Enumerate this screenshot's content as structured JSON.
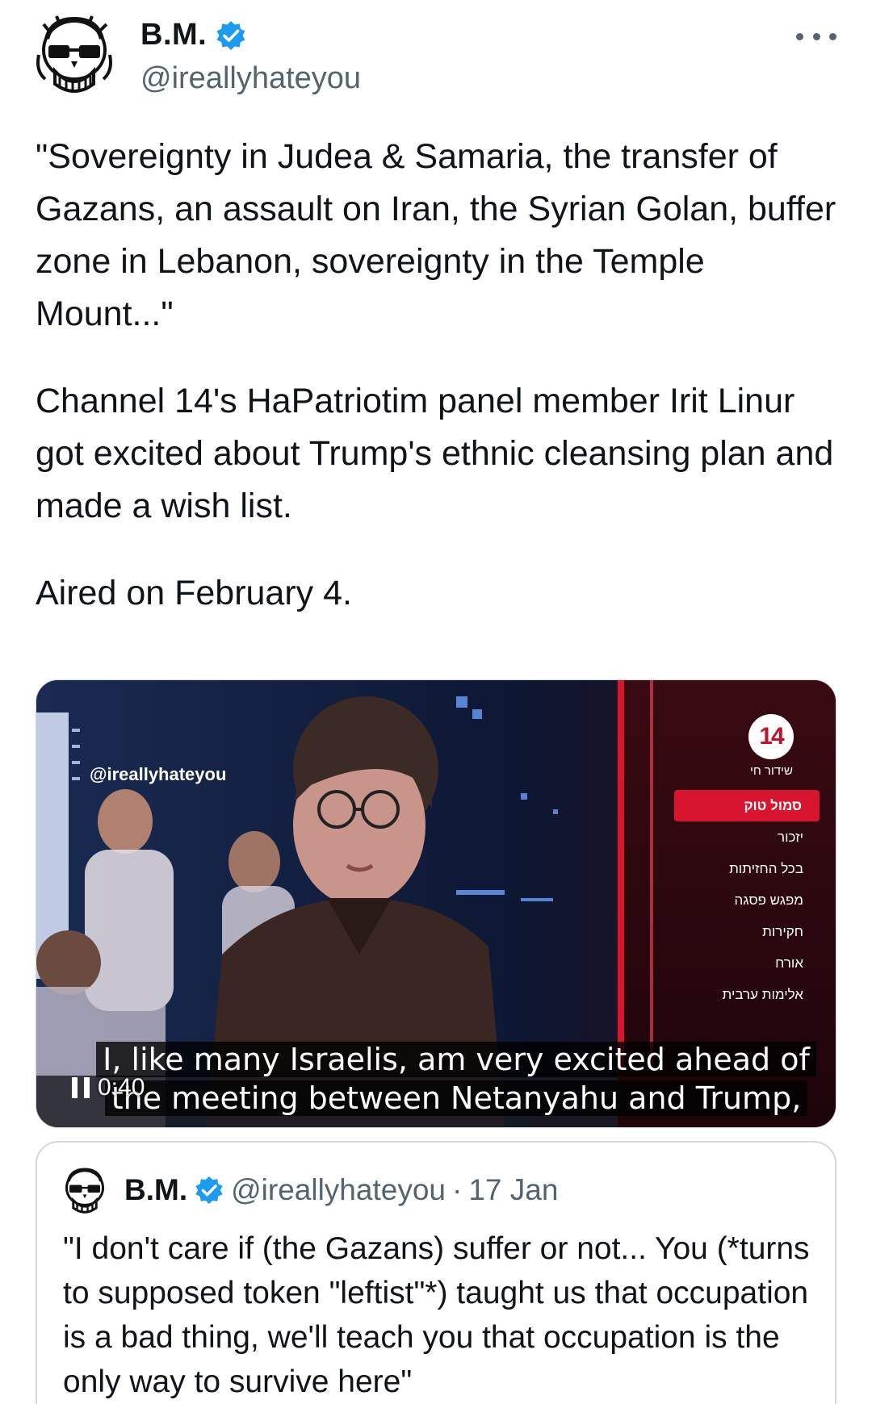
{
  "author": {
    "display_name": "B.M.",
    "handle": "@ireallyhateyou",
    "verified": true,
    "avatar_icon": "skull-with-glasses-avatar"
  },
  "more_icon": "more-horizontal-icon",
  "tweet": {
    "paragraphs": [
      "\"Sovereignty in Judea & Samaria, the transfer of Gazans, an assault on Iran, the Syrian Golan, buffer zone in Lebanon, sovereignty in the Temple Mount...\"",
      "Channel 14's HaPatriotim panel member Irit Linur got excited about Trump's ethnic cleansing plan and made a wish list.",
      "Aired on February 4."
    ]
  },
  "video": {
    "watermark": "@ireallyhateyou",
    "channel_logo": "14",
    "channel_sub": "שידור חי",
    "menu_items": [
      "סמול טוק",
      "יזכור",
      "בכל החזיתות",
      "מפגש פסגה",
      "חקירות",
      "אורח",
      "אלימות ערבית"
    ],
    "active_menu_index": 0,
    "subtitle_line1": "I, like many Israelis, am very excited ahead of",
    "subtitle_line2": "the meeting between Netanyahu and Trump,",
    "timestamp": "0:40",
    "state": "playing",
    "accent_color": "#d9142f"
  },
  "quote": {
    "display_name": "B.M.",
    "handle": "@ireallyhateyou",
    "separator": "·",
    "date": "17 Jan",
    "text": "\"I don't care if (the Gazans) suffer or not... You (*turns to supposed token \"leftist\"*) taught us that occupation is a bad thing, we'll teach you that occupation is the only way to survive here\""
  },
  "colors": {
    "verified_blue": "#1d9bf0",
    "text_primary": "#0f1419",
    "text_secondary": "#536471",
    "border": "#cfd9de"
  }
}
